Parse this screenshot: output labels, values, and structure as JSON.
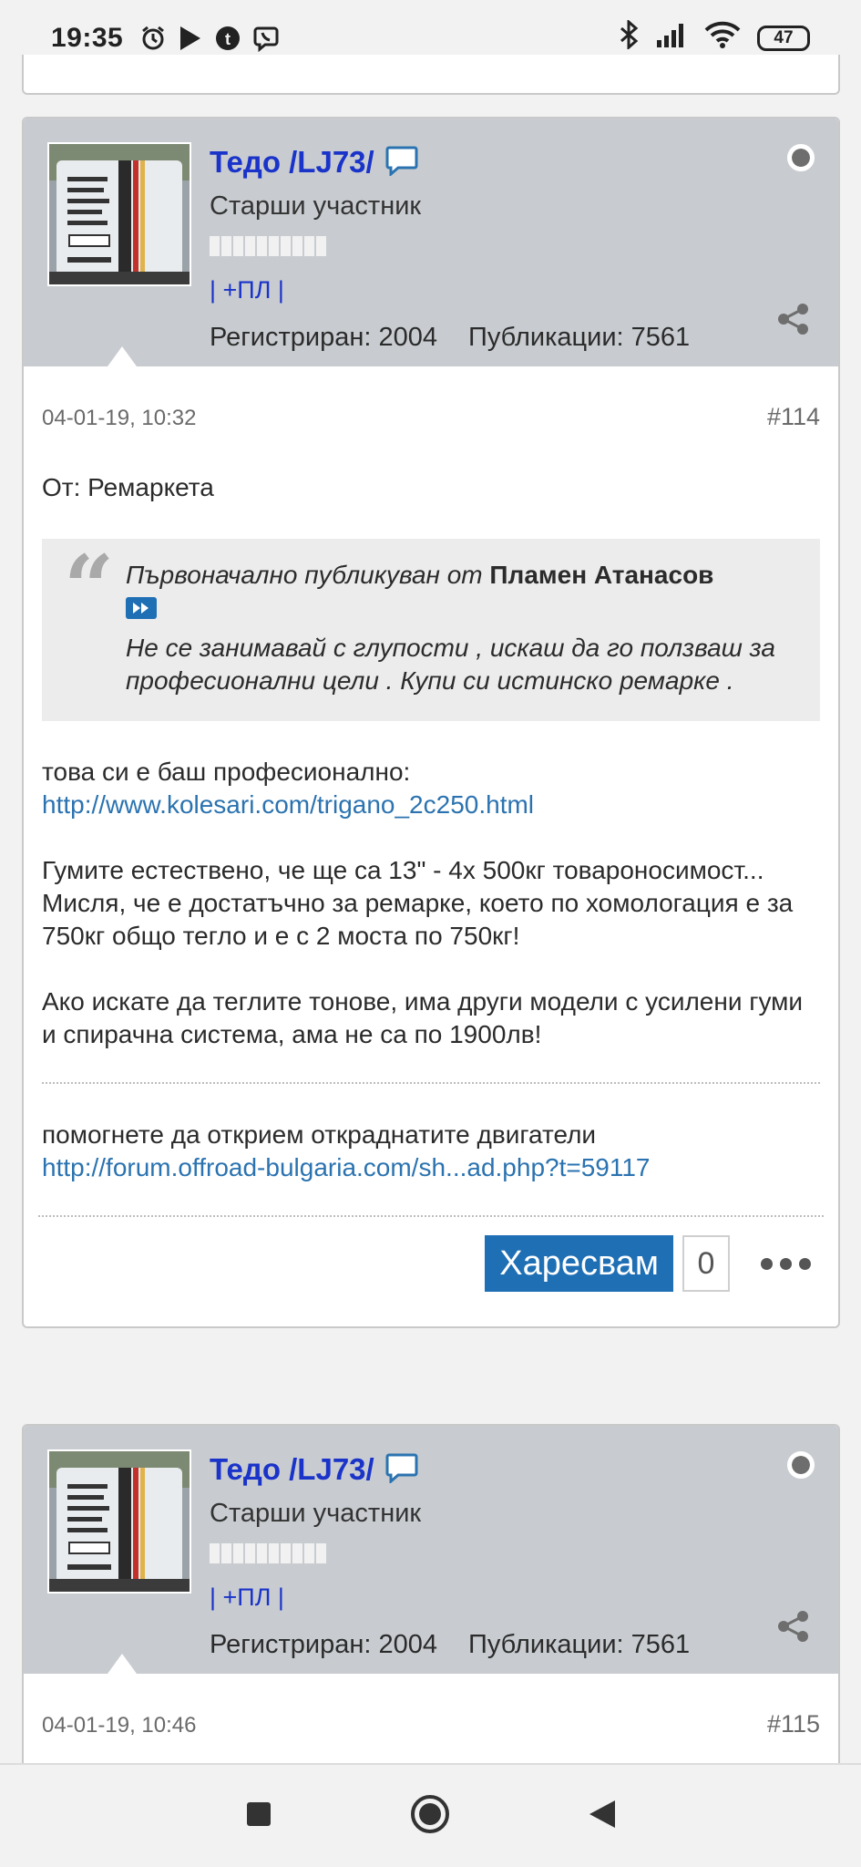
{
  "status_bar": {
    "time": "19:35",
    "left_icons": [
      "alarm-icon",
      "play-store-icon",
      "tumblr-icon",
      "viber-icon"
    ],
    "right_icons": [
      "bluetooth-icon",
      "signal-icon",
      "wifi-icon"
    ],
    "battery": "47"
  },
  "posts": [
    {
      "user": {
        "name": "Тедо /LJ73/",
        "title": "Старши участник",
        "links": "| +ПЛ |",
        "registered": "Регистриран: 2004",
        "publications": "Публикации: 7561"
      },
      "date": "04-01-19, 10:32",
      "number": "#114",
      "subject": "От: Ремаркета",
      "quote": {
        "prefix": "Първоначално публикуван от",
        "author": "Пламен Атанасов",
        "text": "Не се занимавай с глупости , искаш да го ползваш за професионални цели . Купи си истинско ремарке ."
      },
      "body_intro": "това си е баш професионално:",
      "body_link": "http://www.kolesari.com/trigano_2c250.html",
      "body_p2": "Гумите естествено, че ще са 13\" - 4х 500кг товароносимост... Мисля, че е достатъчно за ремарке, което по хомологация е за 750кг общо тегло и е с 2 моста по 750кг!",
      "body_p3": "Ако искате да теглите тонове, има други модели с усилени гуми и спирачна система, ама не са по 1900лв!",
      "signature_text": "помогнете да открием откраднатите двигатели",
      "signature_link": "http://forum.offroad-bulgaria.com/sh...ad.php?t=59117",
      "like_label": "Харесвам",
      "like_count": "0"
    },
    {
      "user": {
        "name": "Тедо /LJ73/",
        "title": "Старши участник",
        "links": "| +ПЛ |",
        "registered": "Регистриран: 2004",
        "publications": "Публикации: 7561"
      },
      "date": "04-01-19, 10:46",
      "number": "#115"
    }
  ],
  "nav_bar": {
    "buttons": [
      "recents-button",
      "home-button",
      "back-button"
    ]
  },
  "colors": {
    "username": "#1a33c9",
    "link": "#2b73b0",
    "like_button": "#1f6fb5",
    "header_bg": "#c8ccd0"
  }
}
